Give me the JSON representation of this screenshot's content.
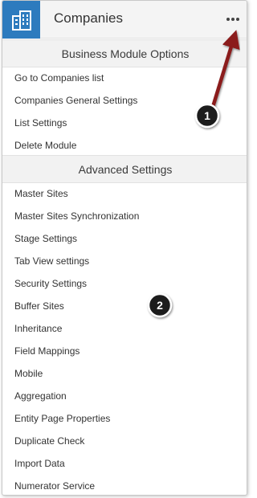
{
  "header": {
    "title": "Companies",
    "module_icon": "building-icon",
    "more_icon": "more-horizontal-icon",
    "accent_color": "#2d7bbe"
  },
  "business_section": {
    "title": "Business Module Options",
    "items": [
      "Go to Companies list",
      "Companies General Settings",
      "List Settings",
      "Delete Module"
    ]
  },
  "advanced_section": {
    "title": "Advanced Settings",
    "items": [
      "Master Sites",
      "Master Sites Synchronization",
      "Stage Settings",
      "Tab View settings",
      "Security Settings",
      "Buffer Sites",
      "Inheritance",
      "Field Mappings",
      "Mobile",
      "Aggregation",
      "Entity Page Properties",
      "Duplicate Check",
      "Import Data",
      "Numerator Service"
    ]
  },
  "annotations": {
    "arrow_color": "#8b1a1a",
    "badge_color": "#1a1a1a",
    "badges": [
      "1",
      "2"
    ]
  }
}
